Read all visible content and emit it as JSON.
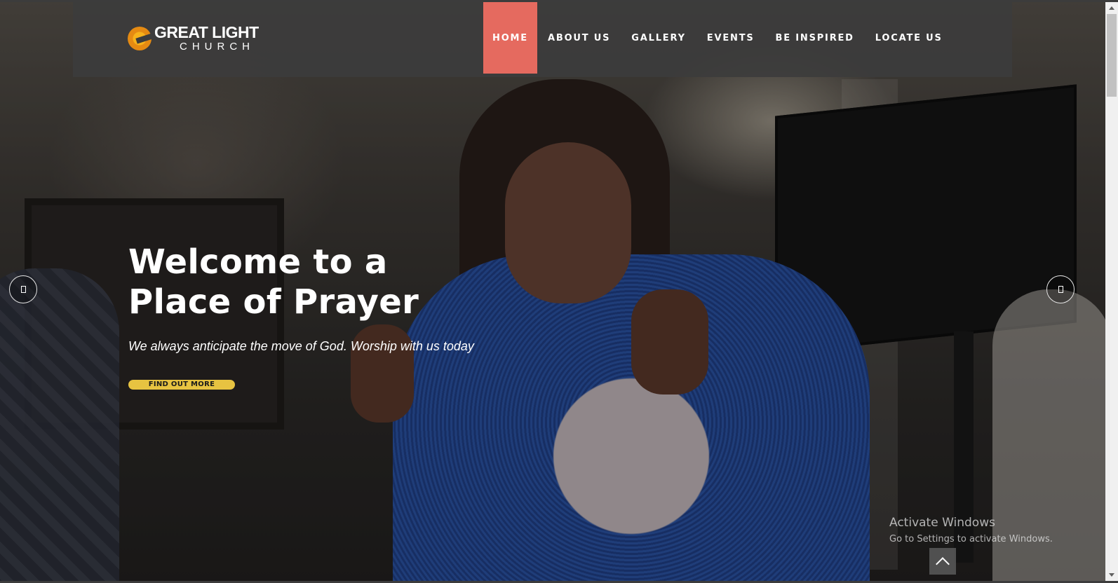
{
  "brand": {
    "name_line1": "GREAT LIGHT",
    "name_line2": "CHURCH",
    "logo_icon": "sunburst-logo-icon",
    "accent_color": "#e56a5f",
    "cta_color": "#e7c341"
  },
  "nav": {
    "items": [
      {
        "label": "HOME",
        "active": true
      },
      {
        "label": "ABOUT US",
        "active": false
      },
      {
        "label": "GALLERY",
        "active": false
      },
      {
        "label": "EVENTS",
        "active": false
      },
      {
        "label": "BE INSPIRED",
        "active": false
      },
      {
        "label": "LOCATE US",
        "active": false
      }
    ]
  },
  "hero": {
    "title_line1": "Welcome to a",
    "title_line2": "Place of Prayer",
    "subtitle": "We always anticipate the move of God. Worship with us today",
    "cta_label": "FIND OUT MORE",
    "prev_icon": "slider-prev-icon",
    "next_icon": "slider-next-icon"
  },
  "watermark": {
    "line1": "Activate Windows",
    "line2": "Go to Settings to activate Windows."
  },
  "back_to_top": {
    "icon": "chevron-up-icon"
  }
}
